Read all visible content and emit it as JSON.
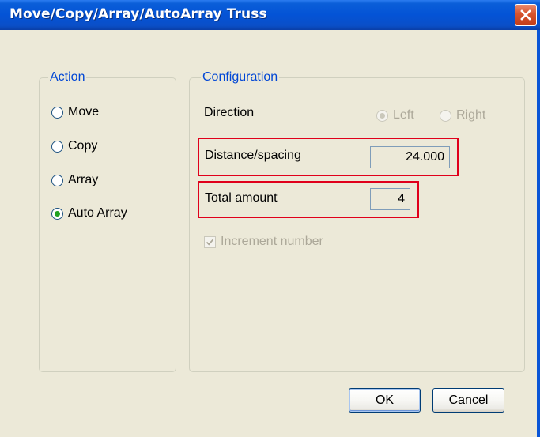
{
  "window": {
    "title": "Move/Copy/Array/AutoArray Truss",
    "close_icon": "close-x-icon"
  },
  "colors": {
    "titlebar": "#0453d6",
    "legend_text": "#0046d5",
    "highlight": "#e0001b",
    "radio_checked": "#21a121"
  },
  "action_group": {
    "legend": "Action",
    "options": [
      {
        "label": "Move",
        "checked": false
      },
      {
        "label": "Copy",
        "checked": false
      },
      {
        "label": "Array",
        "checked": false
      },
      {
        "label": "Auto Array",
        "checked": true
      }
    ]
  },
  "configuration_group": {
    "legend": "Configuration",
    "direction": {
      "label": "Direction",
      "left_label": "Left",
      "right_label": "Right",
      "selected": "Left",
      "enabled": false
    },
    "distance": {
      "label": "Distance/spacing",
      "value": "24.000"
    },
    "total_amount": {
      "label": "Total amount",
      "value": "4"
    },
    "increment": {
      "label": "Increment number",
      "checked": true,
      "enabled": false
    }
  },
  "buttons": {
    "ok": "OK",
    "cancel": "Cancel"
  }
}
